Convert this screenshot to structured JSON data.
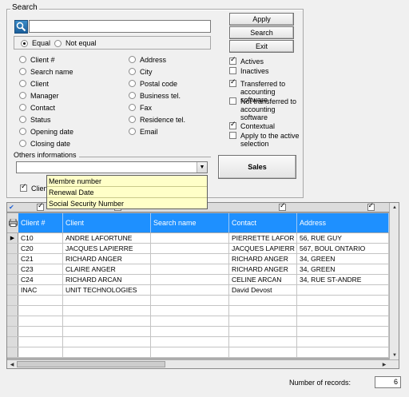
{
  "search": {
    "title": "Search",
    "input_value": "",
    "match_equal": "Equal",
    "match_not_equal": "Not equal",
    "left_fields": [
      "Client #",
      "Search name",
      "Client",
      "Manager",
      "Contact",
      "Status",
      "Opening date",
      "Closing date"
    ],
    "right_fields": [
      "Address",
      "City",
      "Postal code",
      "Business tel.",
      "Fax",
      "Residence tel.",
      "Email"
    ],
    "others_label": "Others informations",
    "dropdown_items": [
      "Membre number",
      "Renewal Date",
      "Social Security Number"
    ],
    "client_check_label": "Client"
  },
  "buttons": {
    "apply": "Apply",
    "search": "Search",
    "exit": "Exit",
    "sales": "Sales"
  },
  "filters": {
    "actives": "Actives",
    "inactives": "Inactives",
    "transferred": "Transferred to accounting software",
    "not_transferred": "Not transferred to accounting software",
    "contextual": "Contextual",
    "apply_active": "Apply to the active selection"
  },
  "grid": {
    "columns": [
      "Client #",
      "Client",
      "Search name",
      "Contact",
      "Address"
    ],
    "rows": [
      [
        "C10",
        "ANDRE LAFORTUNE",
        "",
        "PIERRETTE LAFOR",
        "56, RUE GUY"
      ],
      [
        "C20",
        "JACQUES LAPIERRE",
        "",
        "JACQUES LAPIERR",
        "567, BOUL ONTARIO"
      ],
      [
        "C21",
        "RICHARD ANGER",
        "",
        "RICHARD ANGER",
        "34, GREEN"
      ],
      [
        "C23",
        "CLAIRE ANGER",
        "",
        "RICHARD ANGER",
        "34, GREEN"
      ],
      [
        "C24",
        "RICHARD ARCAN",
        "",
        "CELINE ARCAN",
        "34, RUE ST-ANDRE"
      ],
      [
        "INAC",
        "UNIT TECHNOLOGIES",
        "",
        "David Devost",
        ""
      ]
    ]
  },
  "footer": {
    "records_label": "Number of records:",
    "records_value": "6"
  }
}
